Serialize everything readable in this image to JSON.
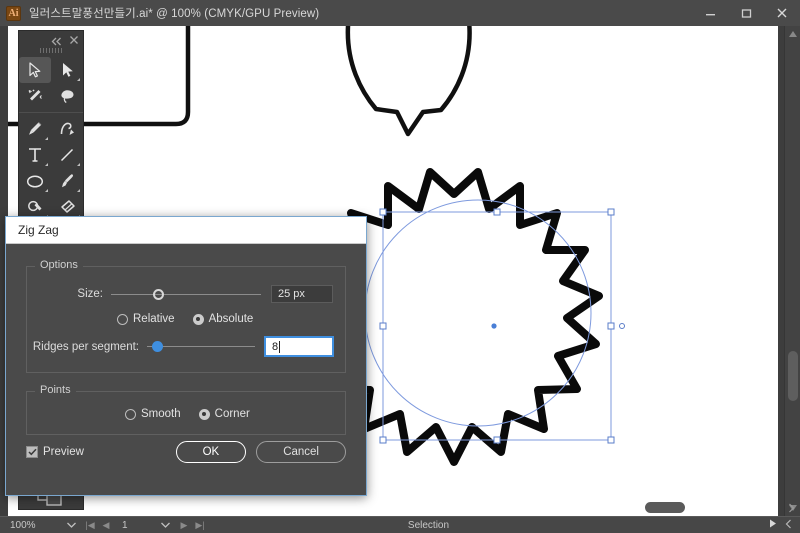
{
  "window": {
    "title": "일러스트말풍선만들기.ai* @ 100% (CMYK/GPU Preview)",
    "app_icon": "ai-logo-icon",
    "controls": {
      "minimize": "minimize-icon",
      "maximize": "maximize-icon",
      "close": "close-icon"
    }
  },
  "tools_panel": {
    "collapse_icon": "double-chevron-left-icon",
    "close_icon": "close-icon",
    "grip": "drag-grip",
    "items": [
      {
        "name": "selection-tool",
        "selected": true,
        "has_flyout": false
      },
      {
        "name": "direct-selection-tool",
        "selected": false,
        "has_flyout": true
      },
      {
        "name": "magic-wand-tool",
        "selected": false,
        "has_flyout": false
      },
      {
        "name": "lasso-tool",
        "selected": false,
        "has_flyout": false
      },
      {
        "name": "pen-tool",
        "selected": false,
        "has_flyout": true
      },
      {
        "name": "curvature-tool",
        "selected": false,
        "has_flyout": false
      },
      {
        "name": "type-tool",
        "selected": false,
        "has_flyout": true
      },
      {
        "name": "line-segment-tool",
        "selected": false,
        "has_flyout": true
      },
      {
        "name": "ellipse-tool",
        "selected": false,
        "has_flyout": true
      },
      {
        "name": "paintbrush-tool",
        "selected": false,
        "has_flyout": true
      },
      {
        "name": "shaper-tool",
        "selected": false,
        "has_flyout": true
      },
      {
        "name": "eraser-tool",
        "selected": false,
        "has_flyout": true
      },
      {
        "name": "rotate-tool",
        "selected": false,
        "has_flyout": true
      },
      {
        "name": "free-transform-tool",
        "selected": false,
        "has_flyout": true
      }
    ]
  },
  "dialog": {
    "title": "Zig Zag",
    "options_group_label": "Options",
    "size": {
      "label": "Size:",
      "value": "25 px",
      "slider_percent": 28
    },
    "size_mode": {
      "relative_label": "Relative",
      "absolute_label": "Absolute",
      "selected": "Absolute"
    },
    "ridges": {
      "label": "Ridges per segment:",
      "value": "8",
      "slider_percent": 5
    },
    "points_group_label": "Points",
    "points": {
      "smooth_label": "Smooth",
      "corner_label": "Corner",
      "selected": "Corner"
    },
    "preview": {
      "label": "Preview",
      "checked": true
    },
    "buttons": {
      "ok": "OK",
      "cancel": "Cancel"
    }
  },
  "status_bar": {
    "zoom": "100%",
    "page": "1",
    "tool": "Selection"
  },
  "colors": {
    "accent_blue": "#3f8fe0",
    "dialog_bg": "#4a4a4a",
    "app_bg": "#3d3d3d",
    "selection_blue": "#6f8fd6",
    "titlebar": "#4a4a4a"
  },
  "artwork": {
    "shapes": [
      "rounded-rect-speech-bubble",
      "round-speech-bubble",
      "zigzag-star-shape"
    ],
    "selected_shape": "zigzag-star-shape"
  }
}
